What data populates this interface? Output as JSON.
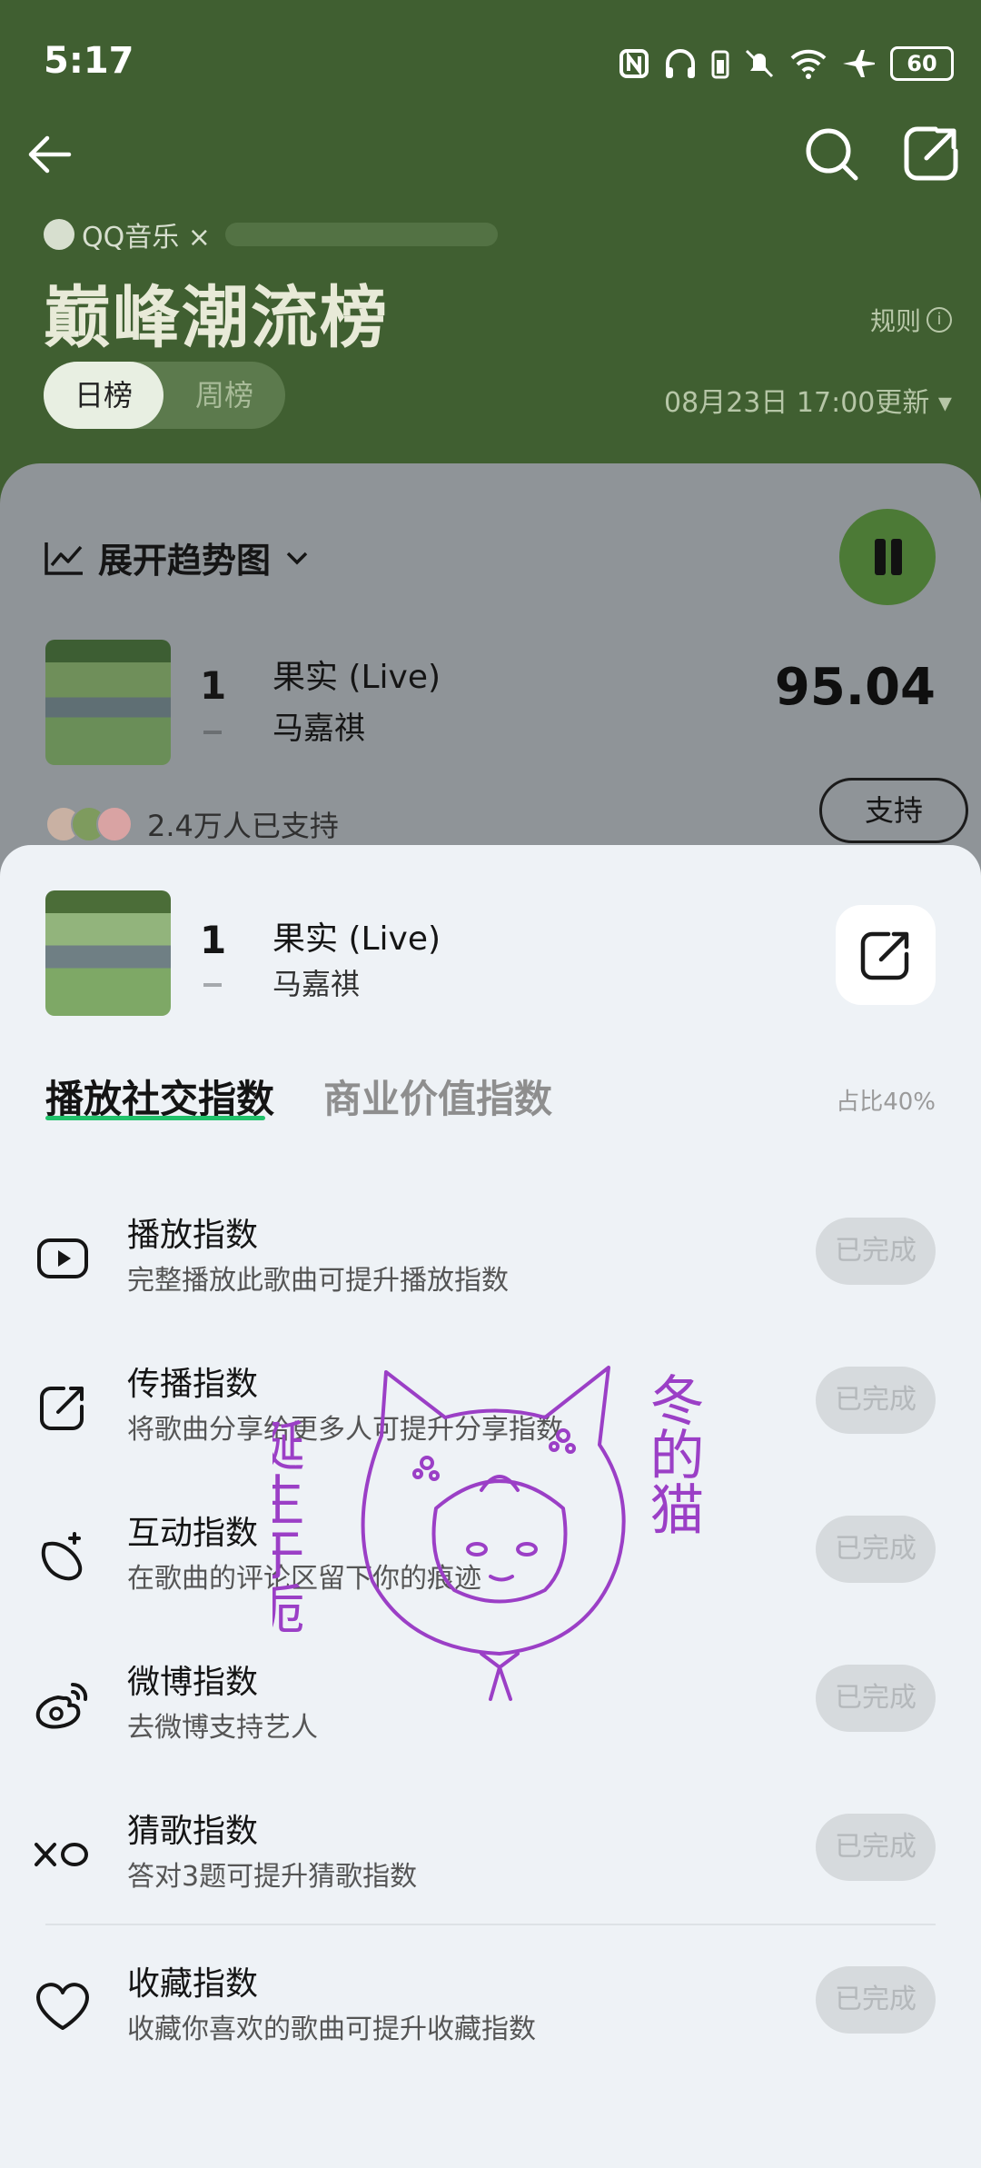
{
  "status_bar": {
    "time": "5:17",
    "battery": "60"
  },
  "header": {
    "brand": "QQ音乐 ×",
    "title": "巅峰潮流榜",
    "rules": "规则",
    "tabs": [
      "日榜",
      "周榜"
    ],
    "updated": "08月23日 17:00更新"
  },
  "trend": {
    "label": "展开趋势图"
  },
  "top_entry": {
    "rank": "1",
    "title": "果实 (Live)",
    "artist": "马嘉祺",
    "score": "95.04",
    "supporters": "2.4万人已支持",
    "support_button": "支持"
  },
  "sheet": {
    "rank": "1",
    "title": "果实 (Live)",
    "artist": "马嘉祺",
    "tabs": [
      "播放社交指数",
      "商业价值指数"
    ],
    "ratio": "占比40%",
    "tasks": [
      {
        "icon": "play-icon",
        "title": "播放指数",
        "desc": "完整播放此歌曲可提升播放指数",
        "button": "已完成"
      },
      {
        "icon": "share-icon",
        "title": "传播指数",
        "desc": "将歌曲分享给更多人可提升分享指数",
        "button": "已完成"
      },
      {
        "icon": "interaction-icon",
        "title": "互动指数",
        "desc": "在歌曲的评论区留下你的痕迹",
        "button": "已完成"
      },
      {
        "icon": "weibo-icon",
        "title": "微博指数",
        "desc": "去微博支持艺人",
        "button": "已完成"
      },
      {
        "icon": "guess-icon",
        "title": "猜歌指数",
        "desc": "答对3题可提升猜歌指数",
        "button": "已完成"
      },
      {
        "icon": "heart-icon",
        "title": "收藏指数",
        "desc": "收藏你喜欢的歌曲可提升收藏指数",
        "button": "已完成"
      }
    ]
  },
  "watermark": {
    "left": "诞生于栀",
    "right": "冬的猫"
  },
  "colors": {
    "header_green": "#405f31",
    "accent_green": "#21c26b",
    "sheet_bg": "#eef2f6"
  }
}
